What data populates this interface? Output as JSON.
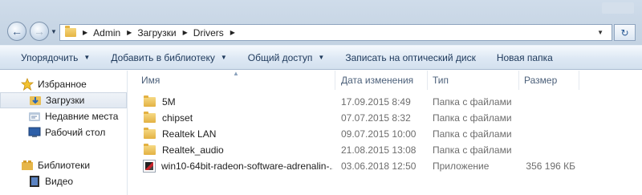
{
  "address": {
    "crumbs": [
      "Admin",
      "Загрузки",
      "Drivers"
    ]
  },
  "toolbar": {
    "organize": "Упорядочить",
    "add_to_library": "Добавить в библиотеку",
    "share": "Общий доступ",
    "burn": "Записать на оптический диск",
    "new_folder": "Новая папка"
  },
  "nav": {
    "favorites": "Избранное",
    "downloads": "Загрузки",
    "recent": "Недавние места",
    "desktop": "Рабочий стол",
    "libraries": "Библиотеки",
    "video": "Видео"
  },
  "columns": {
    "name": "Имя",
    "date": "Дата изменения",
    "type": "Тип",
    "size": "Размер"
  },
  "files": [
    {
      "name": "5M",
      "date": "17.09.2015 8:49",
      "type": "Папка с файлами",
      "size": "",
      "icon": "folder-icon"
    },
    {
      "name": "chipset",
      "date": "07.07.2015 8:32",
      "type": "Папка с файлами",
      "size": "",
      "icon": "folder-icon"
    },
    {
      "name": "Realtek LAN",
      "date": "09.07.2015 10:00",
      "type": "Папка с файлами",
      "size": "",
      "icon": "folder-icon"
    },
    {
      "name": "Realtek_audio",
      "date": "21.08.2015 13:08",
      "type": "Папка с файлами",
      "size": "",
      "icon": "folder-icon"
    },
    {
      "name": "win10-64bit-radeon-software-adrenalin-...",
      "date": "03.06.2018 12:50",
      "type": "Приложение",
      "size": "356 196 КБ",
      "icon": "application-icon"
    }
  ],
  "colors": {
    "accent": "#1e395b",
    "folder": "#e3b142",
    "selected_bg": "#e1e8f1"
  }
}
